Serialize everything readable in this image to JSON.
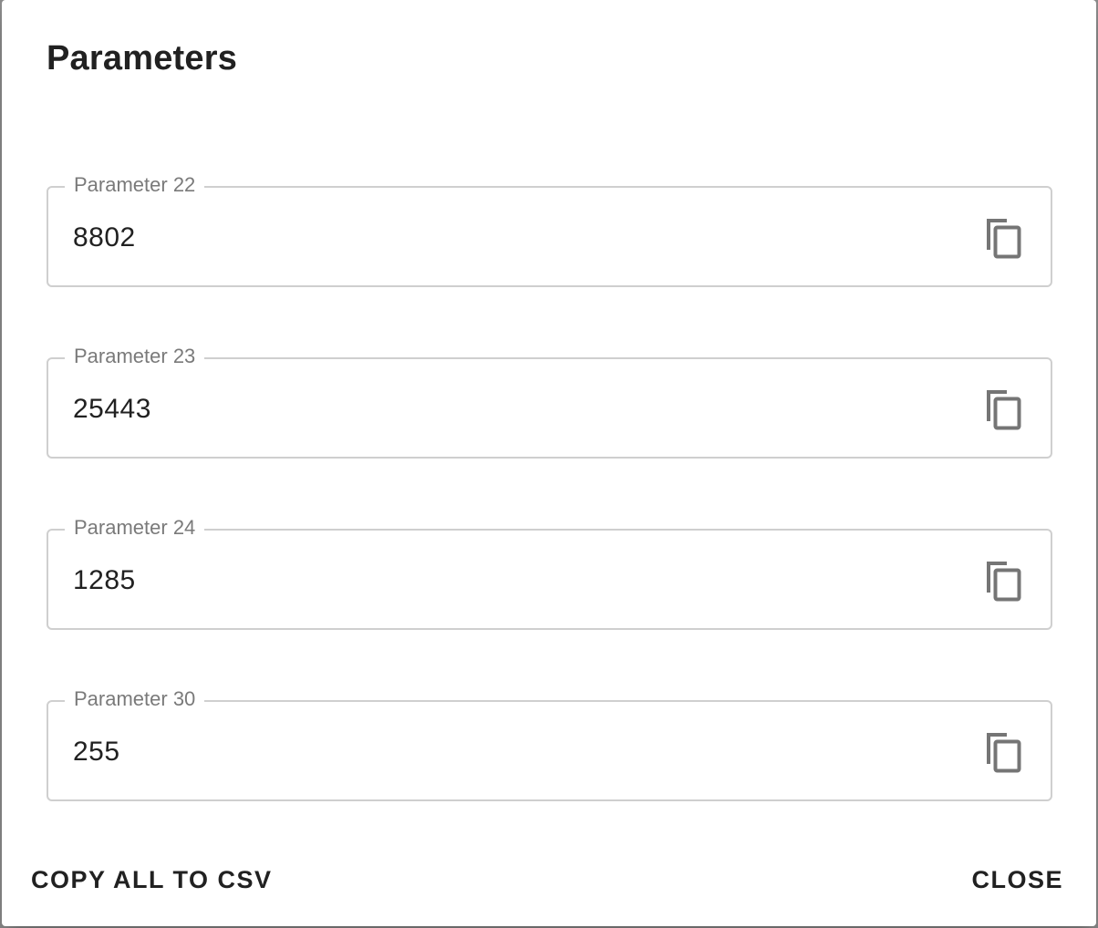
{
  "dialog": {
    "title": "Parameters",
    "fields": [
      {
        "label": "Parameter 22",
        "value": "8802",
        "icon": "copy-icon"
      },
      {
        "label": "Parameter 23",
        "value": "25443",
        "icon": "copy-icon"
      },
      {
        "label": "Parameter 24",
        "value": "1285",
        "icon": "copy-icon"
      },
      {
        "label": "Parameter 30",
        "value": "255",
        "icon": "copy-icon"
      }
    ],
    "actions": {
      "copy_all_label": "COPY ALL TO CSV",
      "close_label": "CLOSE"
    }
  },
  "colors": {
    "text": "#212121",
    "label": "#7a7a7a",
    "border": "#cfcfcf",
    "icon": "#757575"
  }
}
